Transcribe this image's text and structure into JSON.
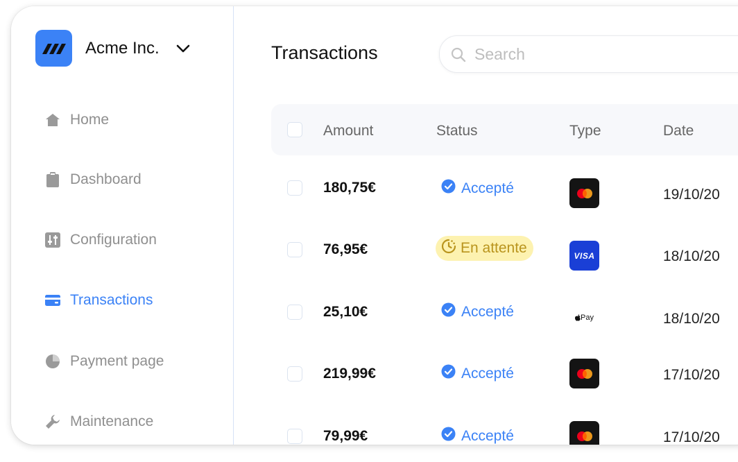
{
  "org": {
    "name": "Acme Inc."
  },
  "nav": [
    {
      "label": "Home",
      "icon": "home-icon",
      "active": false
    },
    {
      "label": "Dashboard",
      "icon": "clipboard-icon",
      "active": false
    },
    {
      "label": "Configuration",
      "icon": "sliders-icon",
      "active": false
    },
    {
      "label": "Transactions",
      "icon": "credit-card-icon",
      "active": true
    },
    {
      "label": "Payment page",
      "icon": "pie-icon",
      "active": false
    },
    {
      "label": "Maintenance",
      "icon": "wrench-icon",
      "active": false
    }
  ],
  "page": {
    "title": "Transactions"
  },
  "search": {
    "placeholder": "Search",
    "value": ""
  },
  "table": {
    "columns": [
      "Amount",
      "Status",
      "Type",
      "Date"
    ],
    "rows": [
      {
        "amount": "180,75€",
        "status": "Accepté",
        "type": "mastercard",
        "date": "19/10/20"
      },
      {
        "amount": "76,95€",
        "status": "En attente",
        "type": "visa",
        "date": "18/10/20"
      },
      {
        "amount": "25,10€",
        "status": "Accepté",
        "type": "apple-pay",
        "date": "18/10/20"
      },
      {
        "amount": "219,99€",
        "status": "Accepté",
        "type": "mastercard",
        "date": "17/10/20"
      },
      {
        "amount": "79,99€",
        "status": "Accepté",
        "type": "mastercard",
        "date": "17/10/20"
      }
    ]
  },
  "card_labels": {
    "visa": "VISA",
    "apple_pay": "Pay"
  },
  "colors": {
    "accent": "#3b82f6",
    "pending_bg": "#fdf2b0",
    "pending_text": "#b9941d",
    "visa": "#1a3fd6",
    "mastercard_bg": "#141414",
    "mastercard_red": "#eb001b",
    "mastercard_orange": "#f79e1b"
  }
}
